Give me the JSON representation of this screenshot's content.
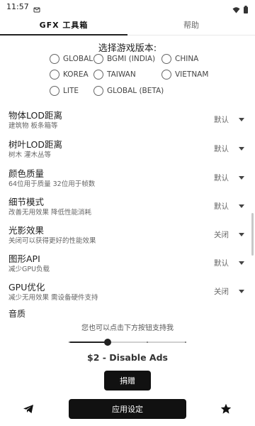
{
  "status_bar": {
    "time": "11:57",
    "icons": [
      "notification-icon",
      "signal-icon",
      "wifi-icon",
      "battery-icon"
    ]
  },
  "tabs": [
    {
      "label": "GFX 工具箱",
      "active": true
    },
    {
      "label": "帮助",
      "active": false
    }
  ],
  "version_selector": {
    "title": "选择游戏版本:",
    "options": [
      {
        "label": "GLOBAL"
      },
      {
        "label": "BGMI (INDIA)"
      },
      {
        "label": "CHINA"
      },
      {
        "label": "KOREA"
      },
      {
        "label": "TAIWAN"
      },
      {
        "label": "VIETNAM"
      },
      {
        "label": "LITE"
      },
      {
        "label": "GLOBAL (BETA)"
      }
    ]
  },
  "settings": [
    {
      "title": "物体LOD距离",
      "subtitle": "建筑物 板条箱等",
      "value": "默认"
    },
    {
      "title": "树叶LOD距离",
      "subtitle": "树木 灌木丛等",
      "value": "默认"
    },
    {
      "title": "颜色质量",
      "subtitle": "64位用于质量 32位用于帧数",
      "value": "默认"
    },
    {
      "title": "细节模式",
      "subtitle": "改善无用效果 降低性能消耗",
      "value": "默认"
    },
    {
      "title": "光影效果",
      "subtitle": "关闭可以获得更好的性能效果",
      "value": "关闭"
    },
    {
      "title": "图形API",
      "subtitle": "减少GPU负载",
      "value": "默认"
    },
    {
      "title": "GPU优化",
      "subtitle": "减少无用效果 需设备硬件支持",
      "value": "关闭"
    }
  ],
  "quality": {
    "label": "音质"
  },
  "donation": {
    "support_text": "您也可以点击下方按钮支持我",
    "slider_value_fraction": 0.33,
    "price_text": "$2 - Disable Ads",
    "donate_label": "捐赠"
  },
  "bottom_bar": {
    "apply_label": "应用设定",
    "left_icon": "telegram-icon",
    "right_icon": "star-icon"
  },
  "colors": {
    "accent": "#111111",
    "text": "#222222",
    "secondary_text": "#666666"
  }
}
